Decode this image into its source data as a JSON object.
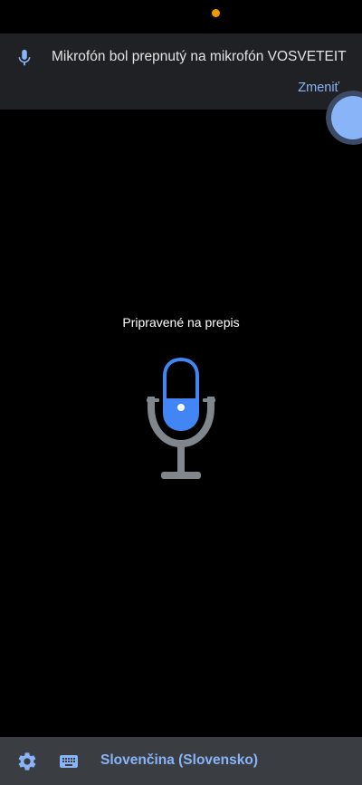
{
  "colors": {
    "accent": "#8ab4f8",
    "mic_blue": "#4285f4",
    "mic_gray": "#80868b",
    "status_dot": "#f29900",
    "bubble_outer": "#3c4a66",
    "bubble_inner": "#8ab4f8"
  },
  "banner": {
    "icon": "microphone-icon",
    "message": "Mikrofón bol prepnutý na mikrofón VOSVETEIT",
    "action_label": "Zmeniť"
  },
  "main": {
    "status_text": "Pripravené na prepis",
    "mic_icon": "microphone-icon"
  },
  "bottom_bar": {
    "settings_icon": "gear-icon",
    "keyboard_icon": "keyboard-icon",
    "language_label": "Slovenčina (Slovensko)"
  }
}
